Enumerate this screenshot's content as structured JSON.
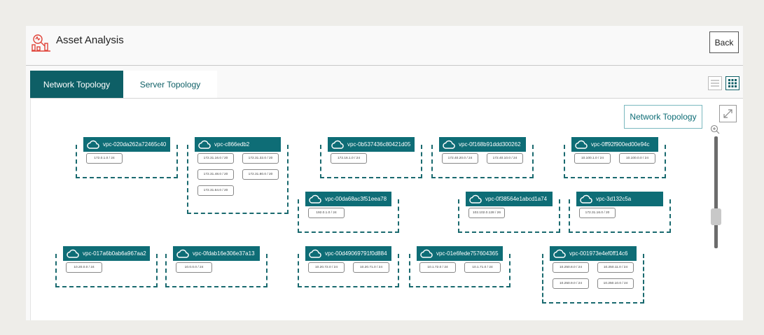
{
  "header": {
    "title": "Asset Analysis",
    "back_label": "Back",
    "icon": "asset-analysis-icon"
  },
  "tabs": [
    {
      "label": "Network Topology",
      "active": true
    },
    {
      "label": "Server Topology",
      "active": false
    }
  ],
  "view_toggle": {
    "list_icon": "list-view-icon",
    "grid_icon": "grid-view-icon",
    "selected": "grid"
  },
  "canvas": {
    "topology_button_label": "Network Topology",
    "expand_icon": "expand-icon",
    "zoom": {
      "icon": "zoom-in-icon",
      "level": 0.62
    }
  },
  "colors": {
    "accent": "#0e5f66",
    "node_header": "#0e6d76",
    "dashed_border": "#1a6a6f",
    "page_bg": "#eeede9"
  },
  "vpcs": [
    {
      "id": "vpc-020da262a72465c40",
      "subnets": [
        "172.0.1.0 / 24"
      ]
    },
    {
      "id": "vpc-c866edb2",
      "subnets": [
        "172.31.16.0 / 20",
        "172.31.32.0 / 20",
        "172.31.48.0 / 20",
        "172.31.80.0 / 20",
        "172.31.64.0 / 20"
      ]
    },
    {
      "id": "vpc-0b537436c80421d05",
      "subnets": [
        "172.16.1.0 / 24"
      ]
    },
    {
      "id": "vpc-0f168b91ddd300262",
      "subnets": [
        "172.40.20.0 / 24",
        "172.40.10.0 / 24"
      ]
    },
    {
      "id": "vpc-0ff92f900ed00e94c",
      "subnets": [
        "10.100.1.0 / 24",
        "10.100.0.0 / 24"
      ]
    },
    {
      "id": "vpc-00da68ac3f51eea78",
      "subnets": [
        "192.0.1.0 / 24"
      ]
    },
    {
      "id": "vpc-0f38564e1abcd1a74",
      "subnets": [
        "102.102.0.128 / 26"
      ]
    },
    {
      "id": "vpc-3d132c5a",
      "subnets": [
        "172.31.16.0 / 20"
      ]
    },
    {
      "id": "vpc-017a6b0ab6a967aa2",
      "subnets": [
        "10.20.0.0 / 24"
      ]
    },
    {
      "id": "vpc-0fdab16e306e37a13",
      "subnets": [
        "10.0.0.0 / 24"
      ]
    },
    {
      "id": "vpc-00d49069791f0d884",
      "subnets": [
        "10.20.72.0 / 24",
        "10.20.71.0 / 24"
      ]
    },
    {
      "id": "vpc-01e6fede757604365",
      "subnets": [
        "10.1.72.0 / 24",
        "10.1.71.0 / 24"
      ]
    },
    {
      "id": "vpc-001973e4ef0ff14c6",
      "subnets": [
        "10.250.8.0 / 24",
        "10.250.11.0 / 24",
        "10.250.9.0 / 24",
        "10.250.10.0 / 24"
      ]
    }
  ]
}
